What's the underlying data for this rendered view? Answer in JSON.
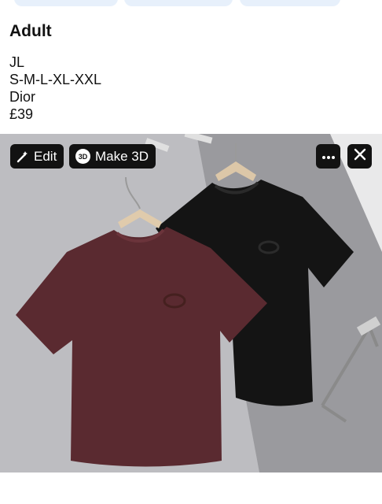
{
  "post": {
    "title": "Adult",
    "details": [
      "JL",
      "S-M-L-XL-XXL",
      "Dior",
      "£39"
    ]
  },
  "image_toolbar": {
    "edit_label": "Edit",
    "make3d_label": "Make 3D",
    "make3d_badge": "3D",
    "more_icon": "ellipsis-icon",
    "close_icon": "close-icon"
  },
  "colors": {
    "toolbar_bg": "#121212",
    "chip_bg": "#e7f0fb",
    "burgundy_shirt": "#5a2a30",
    "black_shirt": "#141414"
  }
}
